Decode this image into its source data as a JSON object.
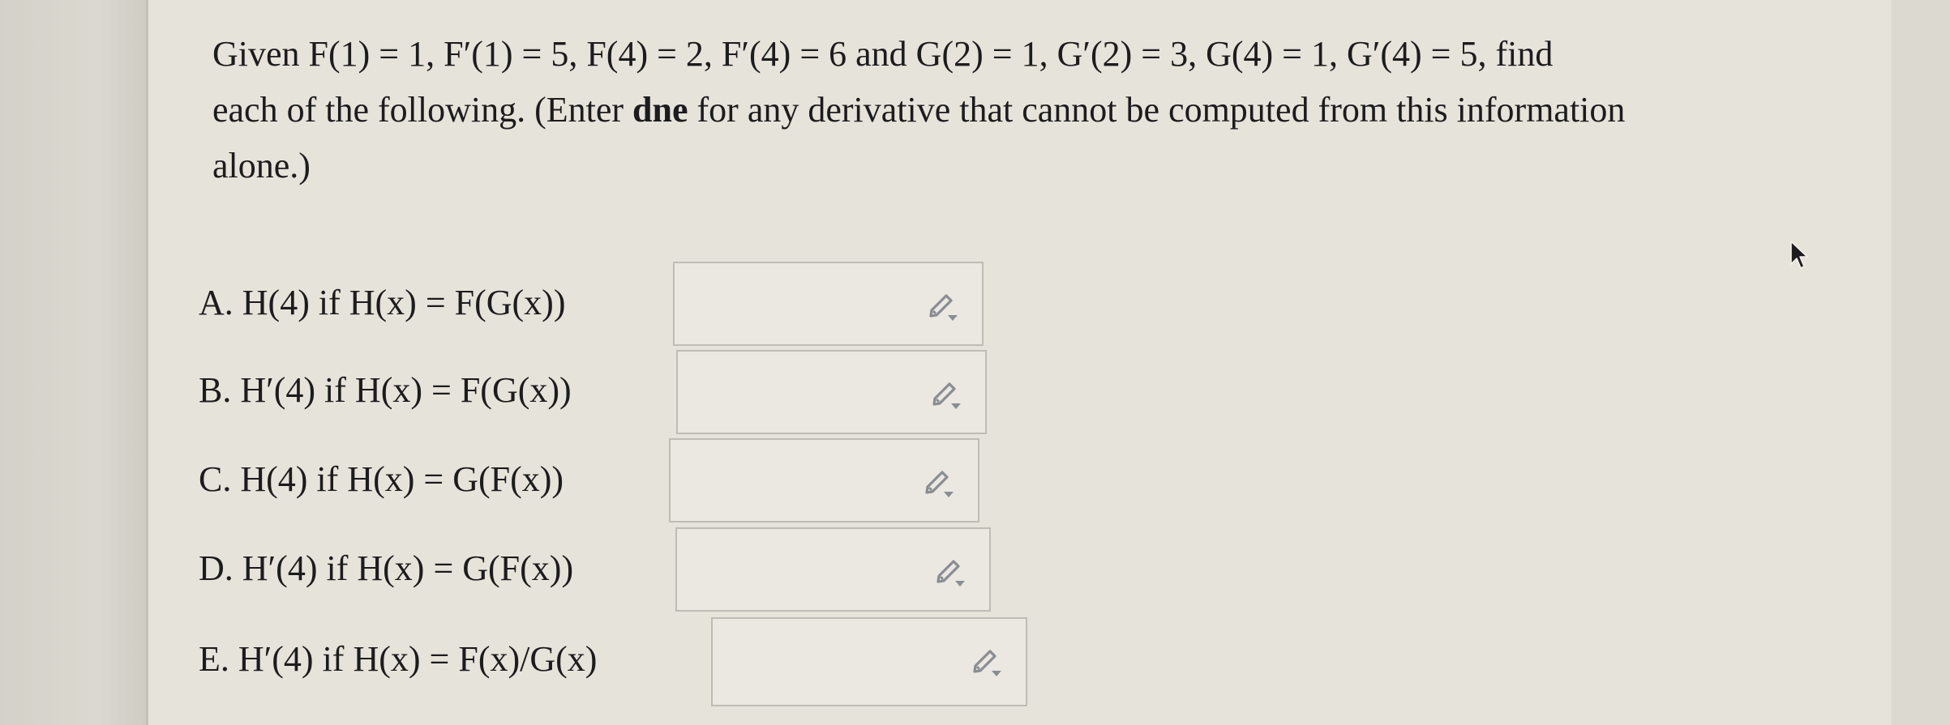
{
  "prompt": {
    "line1": "Given F(1) = 1, F′(1) = 5, F(4) = 2, F′(4) = 6 and G(2) = 1, G′(2) = 3, G(4) = 1, G′(4) = 5, find",
    "line2_pre": "each of the following. (Enter ",
    "line2_bold": "dne",
    "line2_post": " for any derivative that cannot be computed from this information",
    "line3": "alone.)"
  },
  "questions": [
    {
      "label": "A. H(4) if H(x) = F(G(x))",
      "value": ""
    },
    {
      "label": "B. H′(4) if H(x) = F(G(x))",
      "value": ""
    },
    {
      "label": "C. H(4) if H(x) = G(F(x))",
      "value": ""
    },
    {
      "label": "D. H′(4) if H(x) = G(F(x))",
      "value": ""
    },
    {
      "label": "E. H′(4) if H(x) = F(x)/G(x)",
      "value": ""
    }
  ],
  "icons": {
    "answer_tool": "pencil-dropdown-icon",
    "pointer": "mouse-cursor-icon"
  },
  "colors": {
    "panel": "#e6e3da",
    "text": "#1c1c1e",
    "box_border": "#bebcb4",
    "icon": "#8a8d92"
  }
}
